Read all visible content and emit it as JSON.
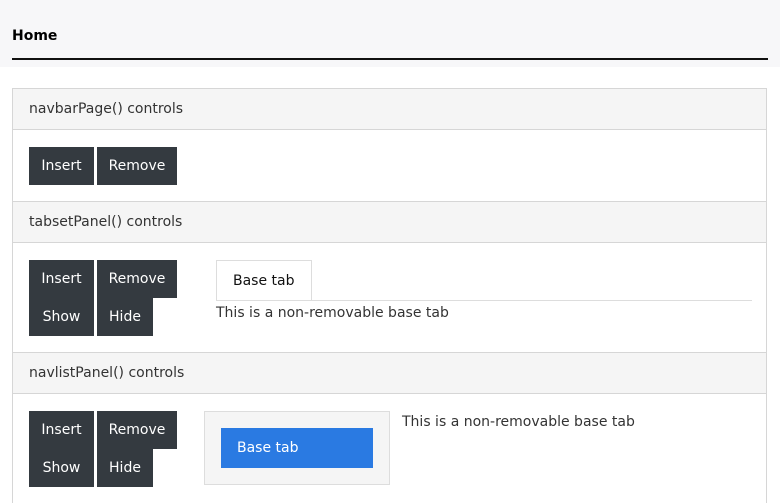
{
  "navbar": {
    "tabs": [
      {
        "label": "Home",
        "active": true
      }
    ]
  },
  "panels": [
    {
      "title": "navbarPage() controls",
      "buttons": [
        "Insert",
        "Remove"
      ]
    },
    {
      "title": "tabsetPanel() controls",
      "buttons": [
        "Insert",
        "Remove",
        "Show",
        "Hide"
      ],
      "tabset": {
        "tabs": [
          {
            "label": "Base tab",
            "active": true
          }
        ],
        "content": "This is a non-removable base tab"
      }
    },
    {
      "title": "navlistPanel() controls",
      "buttons": [
        "Insert",
        "Remove",
        "Show",
        "Hide"
      ],
      "navlist": {
        "items": [
          {
            "label": "Base tab",
            "active": true
          }
        ],
        "content": "This is a non-removable base tab"
      }
    }
  ],
  "colors": {
    "button_bg": "#343a40",
    "navlist_active": "#2a7ae2"
  }
}
